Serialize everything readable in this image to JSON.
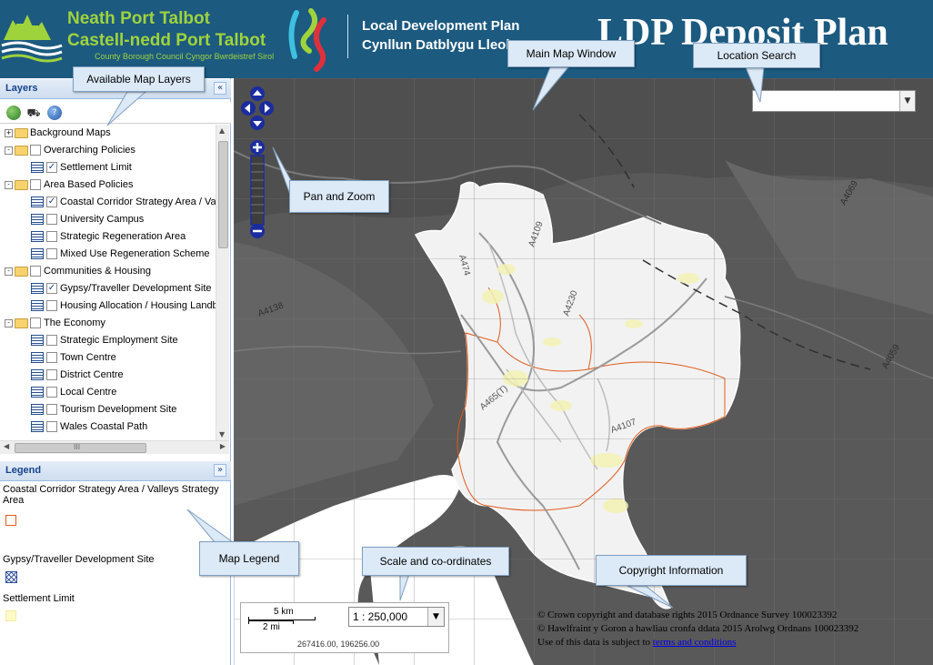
{
  "header": {
    "org_name_en": "Neath Port Talbot",
    "org_name_cy": "Castell-nedd Port Talbot",
    "org_subtitle": "County Borough Council  Cyngor Bwrdeistref Sirol",
    "ldp_title_en": "Local Development Plan",
    "ldp_title_cy": "Cynllun Datblygu Lleol",
    "page_title": "LDP Deposit Plan"
  },
  "layers_panel": {
    "title": "Layers",
    "collapse_symbol": "«",
    "toolbar_icons": [
      "globe-icon",
      "binoculars-icon",
      "help-icon"
    ],
    "tree": [
      {
        "label": "Background Maps",
        "level": 0,
        "type": "group",
        "expander": "+",
        "checkbox": false
      },
      {
        "label": "Overarching Policies",
        "level": 0,
        "type": "group",
        "expander": "-",
        "checkbox": true,
        "checked": false
      },
      {
        "label": "Settlement Limit",
        "level": 1,
        "type": "layer",
        "checked": true
      },
      {
        "label": "Area Based Policies",
        "level": 0,
        "type": "group",
        "expander": "-",
        "checkbox": true,
        "checked": false
      },
      {
        "label": "Coastal Corridor Strategy Area / Va",
        "level": 1,
        "type": "layer",
        "checked": true
      },
      {
        "label": "University Campus",
        "level": 1,
        "type": "layer",
        "checked": false
      },
      {
        "label": "Strategic Regeneration Area",
        "level": 1,
        "type": "layer",
        "checked": false
      },
      {
        "label": "Mixed Use Regeneration Scheme",
        "level": 1,
        "type": "layer",
        "checked": false
      },
      {
        "label": "Communities & Housing",
        "level": 0,
        "type": "group",
        "expander": "-",
        "checkbox": true,
        "checked": false
      },
      {
        "label": "Gypsy/Traveller Development Site",
        "level": 1,
        "type": "layer",
        "checked": true
      },
      {
        "label": "Housing Allocation / Housing Landb",
        "level": 1,
        "type": "layer",
        "checked": false
      },
      {
        "label": "The Economy",
        "level": 0,
        "type": "group",
        "expander": "-",
        "checkbox": true,
        "checked": false
      },
      {
        "label": "Strategic Employment Site",
        "level": 1,
        "type": "layer",
        "checked": false
      },
      {
        "label": "Town Centre",
        "level": 1,
        "type": "layer",
        "checked": false
      },
      {
        "label": "District Centre",
        "level": 1,
        "type": "layer",
        "checked": false
      },
      {
        "label": "Local Centre",
        "level": 1,
        "type": "layer",
        "checked": false
      },
      {
        "label": "Tourism Development Site",
        "level": 1,
        "type": "layer",
        "checked": false
      },
      {
        "label": "Wales Coastal Path",
        "level": 1,
        "type": "layer",
        "checked": false
      }
    ],
    "hscroll_thumb_text": "III"
  },
  "legend_panel": {
    "title": "Legend",
    "collapse_symbol": "»",
    "items": [
      {
        "label": "Coastal Corridor Strategy Area / Valleys Strategy Area",
        "symbol": "orange-outline"
      },
      {
        "label": "Gypsy/Traveller Development Site",
        "symbol": "blue-crosshatch"
      },
      {
        "label": "Settlement Limit",
        "symbol": "pale-yellow-fill"
      }
    ]
  },
  "map": {
    "road_labels": [
      "A474",
      "A4109",
      "A4230",
      "A465(T)",
      "A4107",
      "A4138",
      "A4059",
      "A4069"
    ],
    "scale": {
      "km_label": "5 km",
      "mi_label": "2 mi",
      "ratio": "1 : 250,000",
      "coordinates": "267416.00, 196256.00"
    },
    "copyright": {
      "line1": "© Crown copyright and database rights 2015 Ordnance Survey 100023392",
      "line2": "© Hawlfraint y Goron a hawliau cronfa ddata 2015 Arolwg Ordnans 100023392",
      "line3_prefix": "Use of this data is subject to ",
      "line3_link": "terms and conditions"
    },
    "location_search_value": ""
  },
  "callouts": {
    "available_layers": "Available Map Layers",
    "main_map": "Main Map Window",
    "location_search": "Location Search",
    "pan_zoom": "Pan and Zoom",
    "map_legend": "Map Legend",
    "scale_coords": "Scale and co-ordinates",
    "copyright": "Copyright Information"
  },
  "colors": {
    "header_bg": "#1c5a80",
    "org_green": "#9fd33c",
    "map_dark": "#5a5a5a",
    "boundary_fill": "#f2f2f2",
    "strategy_area_orange": "#e15a1a",
    "callout_bg": "#dce9f6",
    "nav_blue": "#1a2c9e"
  }
}
